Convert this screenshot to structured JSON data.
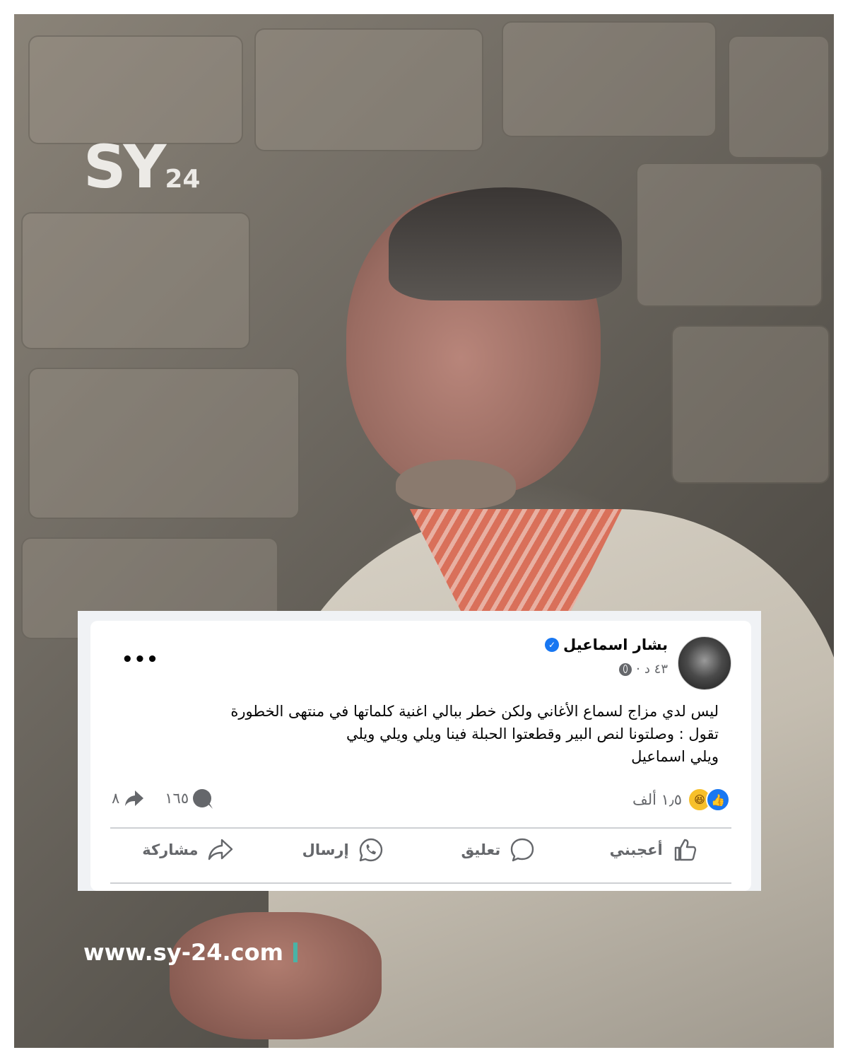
{
  "brand": {
    "logo_main": "SY",
    "logo_num": "24",
    "site_url": "www.sy-24.com",
    "accent": "#4ab3a6"
  },
  "post": {
    "author": "بشار اسماعيل",
    "verified": true,
    "time": "٤٣ د",
    "privacy_icon": "globe-icon",
    "more_label": "•••",
    "text_lines": [
      "ليس لدي مزاج لسماع الأغاني ولكن خطر ببالي اغنية كلماتها في منتهى الخطورة",
      "تقول : وصلتونا لنص البير وقطعتوا الحبلة فينا ويلي ويلي ويلي",
      "ويلي اسماعيل"
    ],
    "reactions_count": "١٫٥ ألف",
    "reaction_icons": [
      "like-icon",
      "haha-icon"
    ],
    "comments_count": "١٦٥",
    "shares_count": "٨",
    "actions": {
      "like": "أعجبني",
      "comment": "تعليق",
      "send": "إرسال",
      "share": "مشاركة"
    },
    "colors": {
      "like_blue": "#1877f2",
      "haha_yellow": "#f7c02b",
      "secondary_text": "#65676b"
    }
  }
}
